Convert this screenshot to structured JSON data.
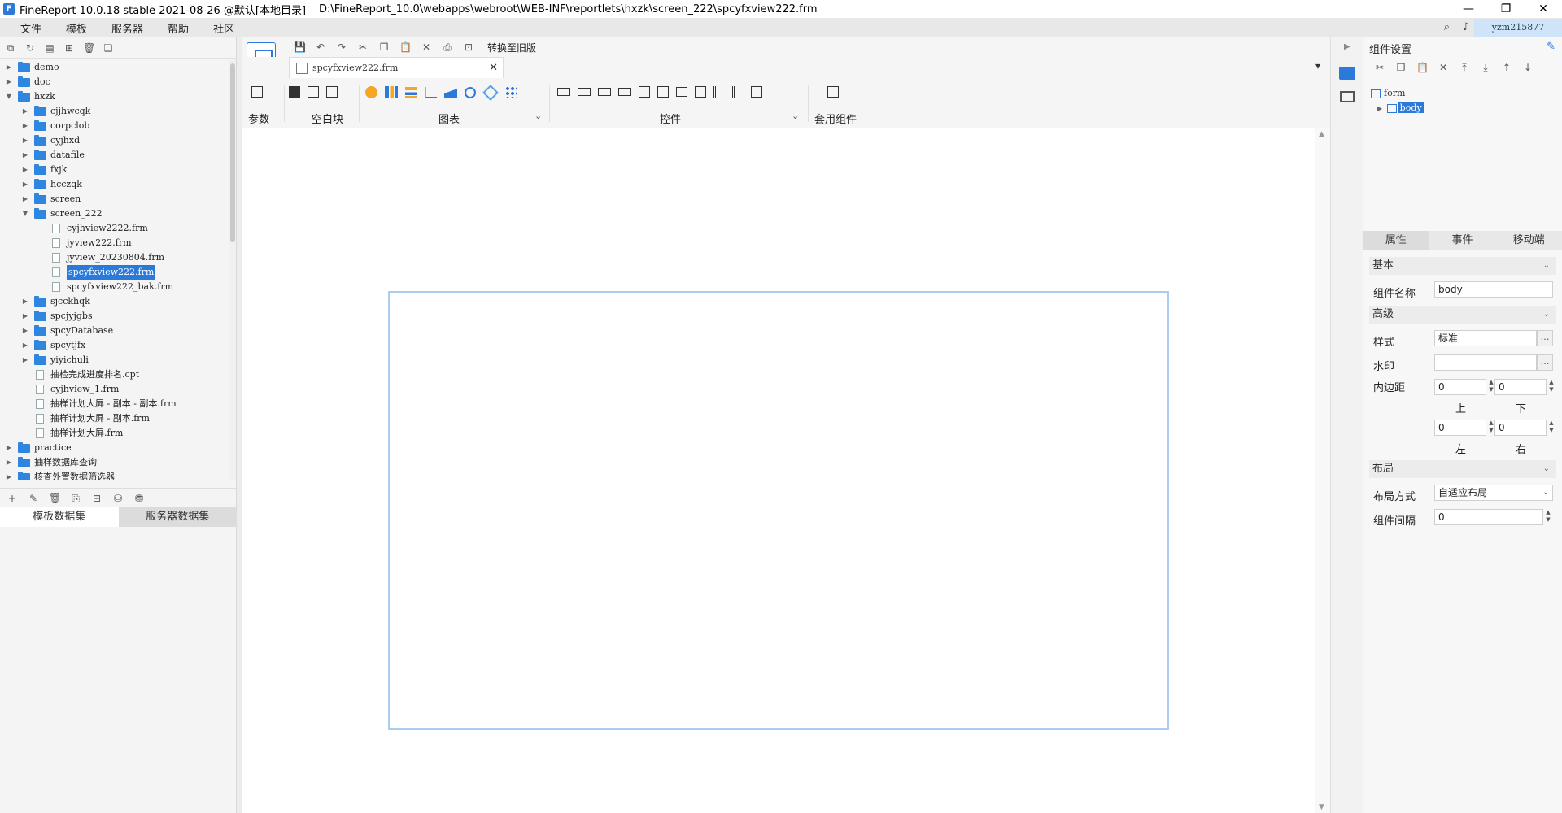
{
  "title": "FineReport 10.0.18 stable 2021-08-26 @默认[本地目录]",
  "path": "D:\\FineReport_10.0\\webapps\\webroot\\WEB-INF\\reportlets\\hxzk\\screen_222\\spcyfxview222.frm",
  "menu": [
    "文件",
    "模板",
    "服务器",
    "帮助",
    "社区"
  ],
  "user": "yzm215877",
  "tree": {
    "items": [
      {
        "label": "demo",
        "type": "folder",
        "depth": 0,
        "open": false
      },
      {
        "label": "doc",
        "type": "folder",
        "depth": 0,
        "open": false
      },
      {
        "label": "hxzk",
        "type": "folder",
        "depth": 0,
        "open": true
      },
      {
        "label": "cjjhwcqk",
        "type": "folder",
        "depth": 1,
        "open": false
      },
      {
        "label": "corpclob",
        "type": "folder",
        "depth": 1,
        "open": false
      },
      {
        "label": "cyjhxd",
        "type": "folder",
        "depth": 1,
        "open": false
      },
      {
        "label": "datafile",
        "type": "folder",
        "depth": 1,
        "open": false
      },
      {
        "label": "fxjk",
        "type": "folder",
        "depth": 1,
        "open": false
      },
      {
        "label": "hcczqk",
        "type": "folder",
        "depth": 1,
        "open": false
      },
      {
        "label": "screen",
        "type": "folder",
        "depth": 1,
        "open": false
      },
      {
        "label": "screen_222",
        "type": "folder",
        "depth": 1,
        "open": true
      },
      {
        "label": "cyjhview2222.frm",
        "type": "file",
        "depth": 2
      },
      {
        "label": "jyview222.frm",
        "type": "file",
        "depth": 2
      },
      {
        "label": "jyview_20230804.frm",
        "type": "file",
        "depth": 2
      },
      {
        "label": "spcyfxview222.frm",
        "type": "file",
        "depth": 2,
        "selected": true
      },
      {
        "label": "spcyfxview222_bak.frm",
        "type": "file",
        "depth": 2
      },
      {
        "label": "sjcckhqk",
        "type": "folder",
        "depth": 1,
        "open": false
      },
      {
        "label": "spcjyjgbs",
        "type": "folder",
        "depth": 1,
        "open": false
      },
      {
        "label": "spcyDatabase",
        "type": "folder",
        "depth": 1,
        "open": false
      },
      {
        "label": "spcytjfx",
        "type": "folder",
        "depth": 1,
        "open": false
      },
      {
        "label": "yiyichuli",
        "type": "folder",
        "depth": 1,
        "open": false
      },
      {
        "label": "抽检完成进度排名.cpt",
        "type": "file",
        "depth": 1
      },
      {
        "label": "cyjhview_1.frm",
        "type": "file",
        "depth": 1
      },
      {
        "label": "抽样计划大屏 - 副本 - 副本.frm",
        "type": "file",
        "depth": 1
      },
      {
        "label": "抽样计划大屏 - 副本.frm",
        "type": "file",
        "depth": 1
      },
      {
        "label": "抽样计划大屏.frm",
        "type": "file",
        "depth": 1
      },
      {
        "label": "practice",
        "type": "folder",
        "depth": 0,
        "open": false
      },
      {
        "label": "抽样数据库查询",
        "type": "folder",
        "depth": 0,
        "open": false
      },
      {
        "label": "核查外置数据筛选器",
        "type": "folder",
        "depth": 0,
        "open": false
      }
    ]
  },
  "dataset_tabs": [
    "模板数据集",
    "服务器数据集"
  ],
  "editor": {
    "convert_label": "转换至旧版",
    "tab_label": "spcyfxview222.frm",
    "groups": {
      "param": "参数",
      "blank": "空白块",
      "chart": "图表",
      "widget": "控件",
      "reuse": "套用组件"
    }
  },
  "right": {
    "header": "组件设置",
    "tree_root": "form",
    "tree_child": "body",
    "tabs": [
      "属性",
      "事件",
      "移动端"
    ],
    "sections": {
      "basic": "基本",
      "advanced": "高级",
      "layout": "布局"
    },
    "fields": {
      "name_label": "组件名称",
      "name_value": "body",
      "style_label": "样式",
      "style_value": "标准",
      "watermark_label": "水印",
      "watermark_value": "",
      "padding_label": "内边距",
      "pad_top": "0",
      "pad_bottom": "0",
      "pad_left": "0",
      "pad_right": "0",
      "top_label": "上",
      "bottom_label": "下",
      "left_label": "左",
      "right_label": "右",
      "layout_mode_label": "布局方式",
      "layout_mode_value": "自适应布局",
      "gap_label": "组件间隔",
      "gap_value": "0"
    }
  },
  "colors": {
    "accent": "#2b79d9",
    "canvas_border": "#a9ccf0"
  }
}
